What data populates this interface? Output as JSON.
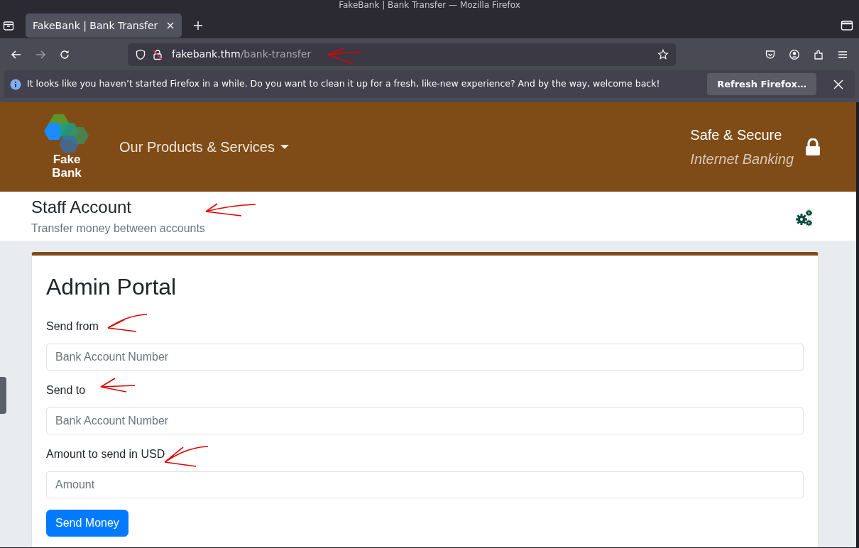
{
  "window": {
    "title": "FakeBank | Bank Transfer — Mozilla Firefox"
  },
  "tabs": [
    {
      "label": "FakeBank | Bank Transfer",
      "selected": true
    }
  ],
  "toolbar": {
    "back_disabled": false,
    "forward_disabled": true
  },
  "address_bar": {
    "host": "fakebank.thm",
    "path": "/bank-transfer"
  },
  "notification": {
    "message": "It looks like you haven’t started Firefox in a while. Do you want to clean it up for a fresh, like-new experience? And by the way, welcome back!",
    "button": "Refresh Firefox…"
  },
  "site": {
    "logo_lines": [
      "Fake",
      "Bank"
    ],
    "nav_item": "Our Products & Services",
    "tagline": "Safe & Secure",
    "tagline_sub": "Internet Banking"
  },
  "page_header": {
    "title": "Staff Account",
    "subtitle": "Transfer money between accounts"
  },
  "form": {
    "title": "Admin Portal",
    "fields": [
      {
        "label": "Send from",
        "placeholder": "Bank Account Number"
      },
      {
        "label": "Send to",
        "placeholder": "Bank Account Number"
      },
      {
        "label": "Amount to send in USD",
        "placeholder": "Amount"
      }
    ],
    "submit": "Send Money"
  }
}
